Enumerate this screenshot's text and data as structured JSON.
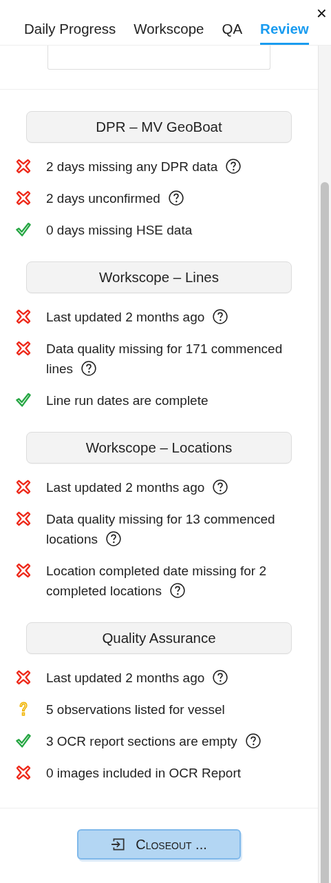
{
  "tabs": [
    {
      "label": "Daily Progress",
      "selected": false
    },
    {
      "label": "Workscope",
      "selected": false
    },
    {
      "label": "QA",
      "selected": false
    },
    {
      "label": "Review",
      "selected": true
    }
  ],
  "close": "×",
  "sections": [
    {
      "title": "DPR – MV GeoBoat",
      "items": [
        {
          "kind": "fail",
          "text": "2 days missing any DPR data",
          "help": true
        },
        {
          "kind": "fail",
          "text": "2 days unconfirmed",
          "help": true
        },
        {
          "kind": "pass",
          "text": "0 days missing HSE data",
          "help": false
        }
      ]
    },
    {
      "title": "Workscope – Lines",
      "items": [
        {
          "kind": "fail",
          "text": "Last updated 2 months ago",
          "help": true
        },
        {
          "kind": "fail",
          "text": "Data quality missing for 171 commenced lines",
          "help": true
        },
        {
          "kind": "pass",
          "text": "Line run dates are complete",
          "help": false
        }
      ]
    },
    {
      "title": "Workscope – Locations",
      "items": [
        {
          "kind": "fail",
          "text": "Last updated 2 months ago",
          "help": true
        },
        {
          "kind": "fail",
          "text": "Data quality missing for 13 commenced locations",
          "help": true
        },
        {
          "kind": "fail",
          "text": "Location completed date missing for 2 completed locations",
          "help": true
        }
      ]
    },
    {
      "title": "Quality Assurance",
      "items": [
        {
          "kind": "fail",
          "text": "Last updated 2 months ago",
          "help": true
        },
        {
          "kind": "warning",
          "text": "5 observations listed for vessel",
          "help": false
        },
        {
          "kind": "pass",
          "text": "3 OCR report sections are empty",
          "help": true
        },
        {
          "kind": "fail",
          "text": "0 images included in OCR Report",
          "help": false
        }
      ]
    }
  ],
  "closeout_button": "Closeout ..."
}
